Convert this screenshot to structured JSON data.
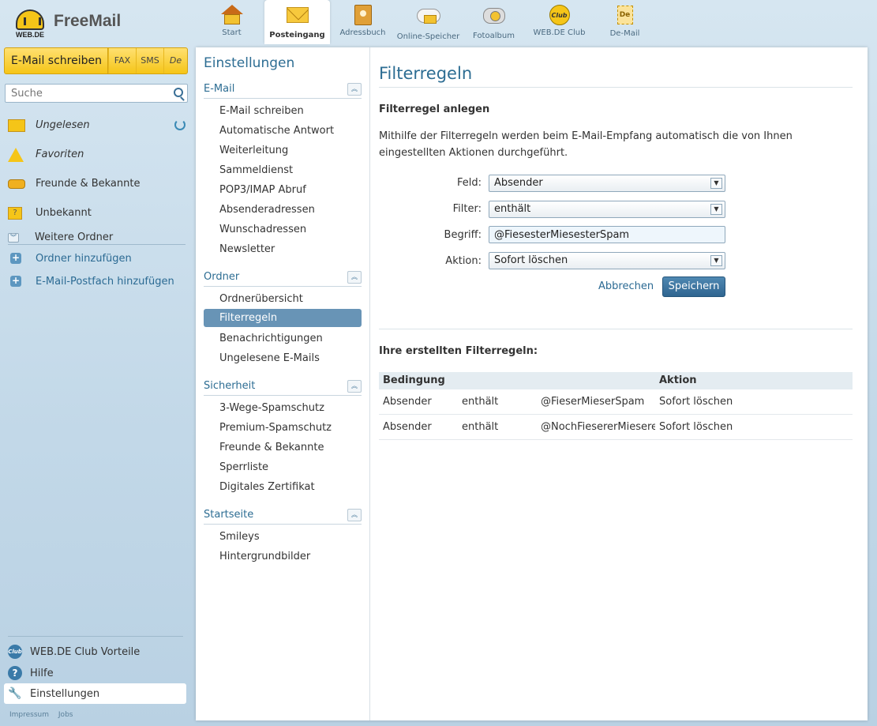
{
  "brand": {
    "logo_text": "WEB.DE",
    "app_name": "FreeMail"
  },
  "nav": [
    {
      "label": "Start",
      "icon": "home-icon",
      "active": false
    },
    {
      "label": "Posteingang",
      "icon": "inbox-icon",
      "active": true
    },
    {
      "label": "Adressbuch",
      "icon": "addressbook-icon",
      "active": false
    },
    {
      "label": "Online-Speicher",
      "icon": "cloud-storage-icon",
      "active": false
    },
    {
      "label": "Fotoalbum",
      "icon": "photo-album-icon",
      "active": false
    },
    {
      "label": "WEB.DE Club",
      "icon": "club-icon",
      "active": false
    },
    {
      "label": "De-Mail",
      "icon": "de-mail-icon",
      "active": false
    }
  ],
  "compose": {
    "label": "E-Mail schreiben",
    "fax": "FAX",
    "sms": "SMS",
    "de": "De"
  },
  "search": {
    "placeholder": "Suche"
  },
  "folders": [
    {
      "label": "Ungelesen",
      "icon": "envelope-icon"
    },
    {
      "label": "Favoriten",
      "icon": "star-icon"
    },
    {
      "label": "Freunde & Bekannte",
      "icon": "friends-icon"
    },
    {
      "label": "Unbekannt",
      "icon": "unknown-sender-icon"
    }
  ],
  "more_folders": "Weitere Ordner",
  "add_folder": "Ordner hinzufügen",
  "add_mailbox": "E-Mail-Postfach hinzufügen",
  "bottom": {
    "club": "WEB.DE Club Vorteile",
    "club_icon_text": "Club",
    "help": "Hilfe",
    "help_icon_text": "?",
    "settings": "Einstellungen",
    "settings_icon_text": "🔧"
  },
  "footer": {
    "impressum": "Impressum",
    "jobs": "Jobs"
  },
  "settings": {
    "title": "Einstellungen",
    "sections": [
      {
        "title": "E-Mail",
        "items": [
          "E-Mail schreiben",
          "Automatische Antwort",
          "Weiterleitung",
          "Sammeldienst",
          "POP3/IMAP Abruf",
          "Absenderadressen",
          "Wunschadressen",
          "Newsletter"
        ]
      },
      {
        "title": "Ordner",
        "items": [
          "Ordnerübersicht",
          "Filterregeln",
          "Benachrichtigungen",
          "Ungelesene E-Mails"
        ]
      },
      {
        "title": "Sicherheit",
        "items": [
          "3-Wege-Spamschutz",
          "Premium-Spamschutz",
          "Freunde & Bekannte",
          "Sperrliste",
          "Digitales Zertifikat"
        ]
      },
      {
        "title": "Startseite",
        "items": [
          "Smileys",
          "Hintergrundbilder"
        ]
      }
    ],
    "active_item": "Filterregeln"
  },
  "content": {
    "title": "Filterregeln",
    "subtitle": "Filterregel anlegen",
    "description": "Mithilfe der Filterregeln werden beim E-Mail-Empfang automatisch die von Ihnen eingestellten Aktionen durchgeführt.",
    "form": {
      "field_label": "Feld:",
      "field_value": "Absender",
      "filter_label": "Filter:",
      "filter_value": "enthält",
      "term_label": "Begriff:",
      "term_value": "@FiesesterMiesesterSpam",
      "action_label": "Aktion:",
      "action_value": "Sofort löschen"
    },
    "cancel": "Abbrechen",
    "save": "Speichern",
    "rules_title": "Ihre erstellten Filterregeln:",
    "table": {
      "headers": {
        "condition": "Bedingung",
        "action": "Aktion"
      },
      "rows": [
        [
          "Absender",
          "enthält",
          "@FieserMieserSpam",
          "Sofort löschen"
        ],
        [
          "Absender",
          "enthält",
          "@NochFiesererMieserer",
          "Sofort löschen"
        ]
      ]
    }
  }
}
